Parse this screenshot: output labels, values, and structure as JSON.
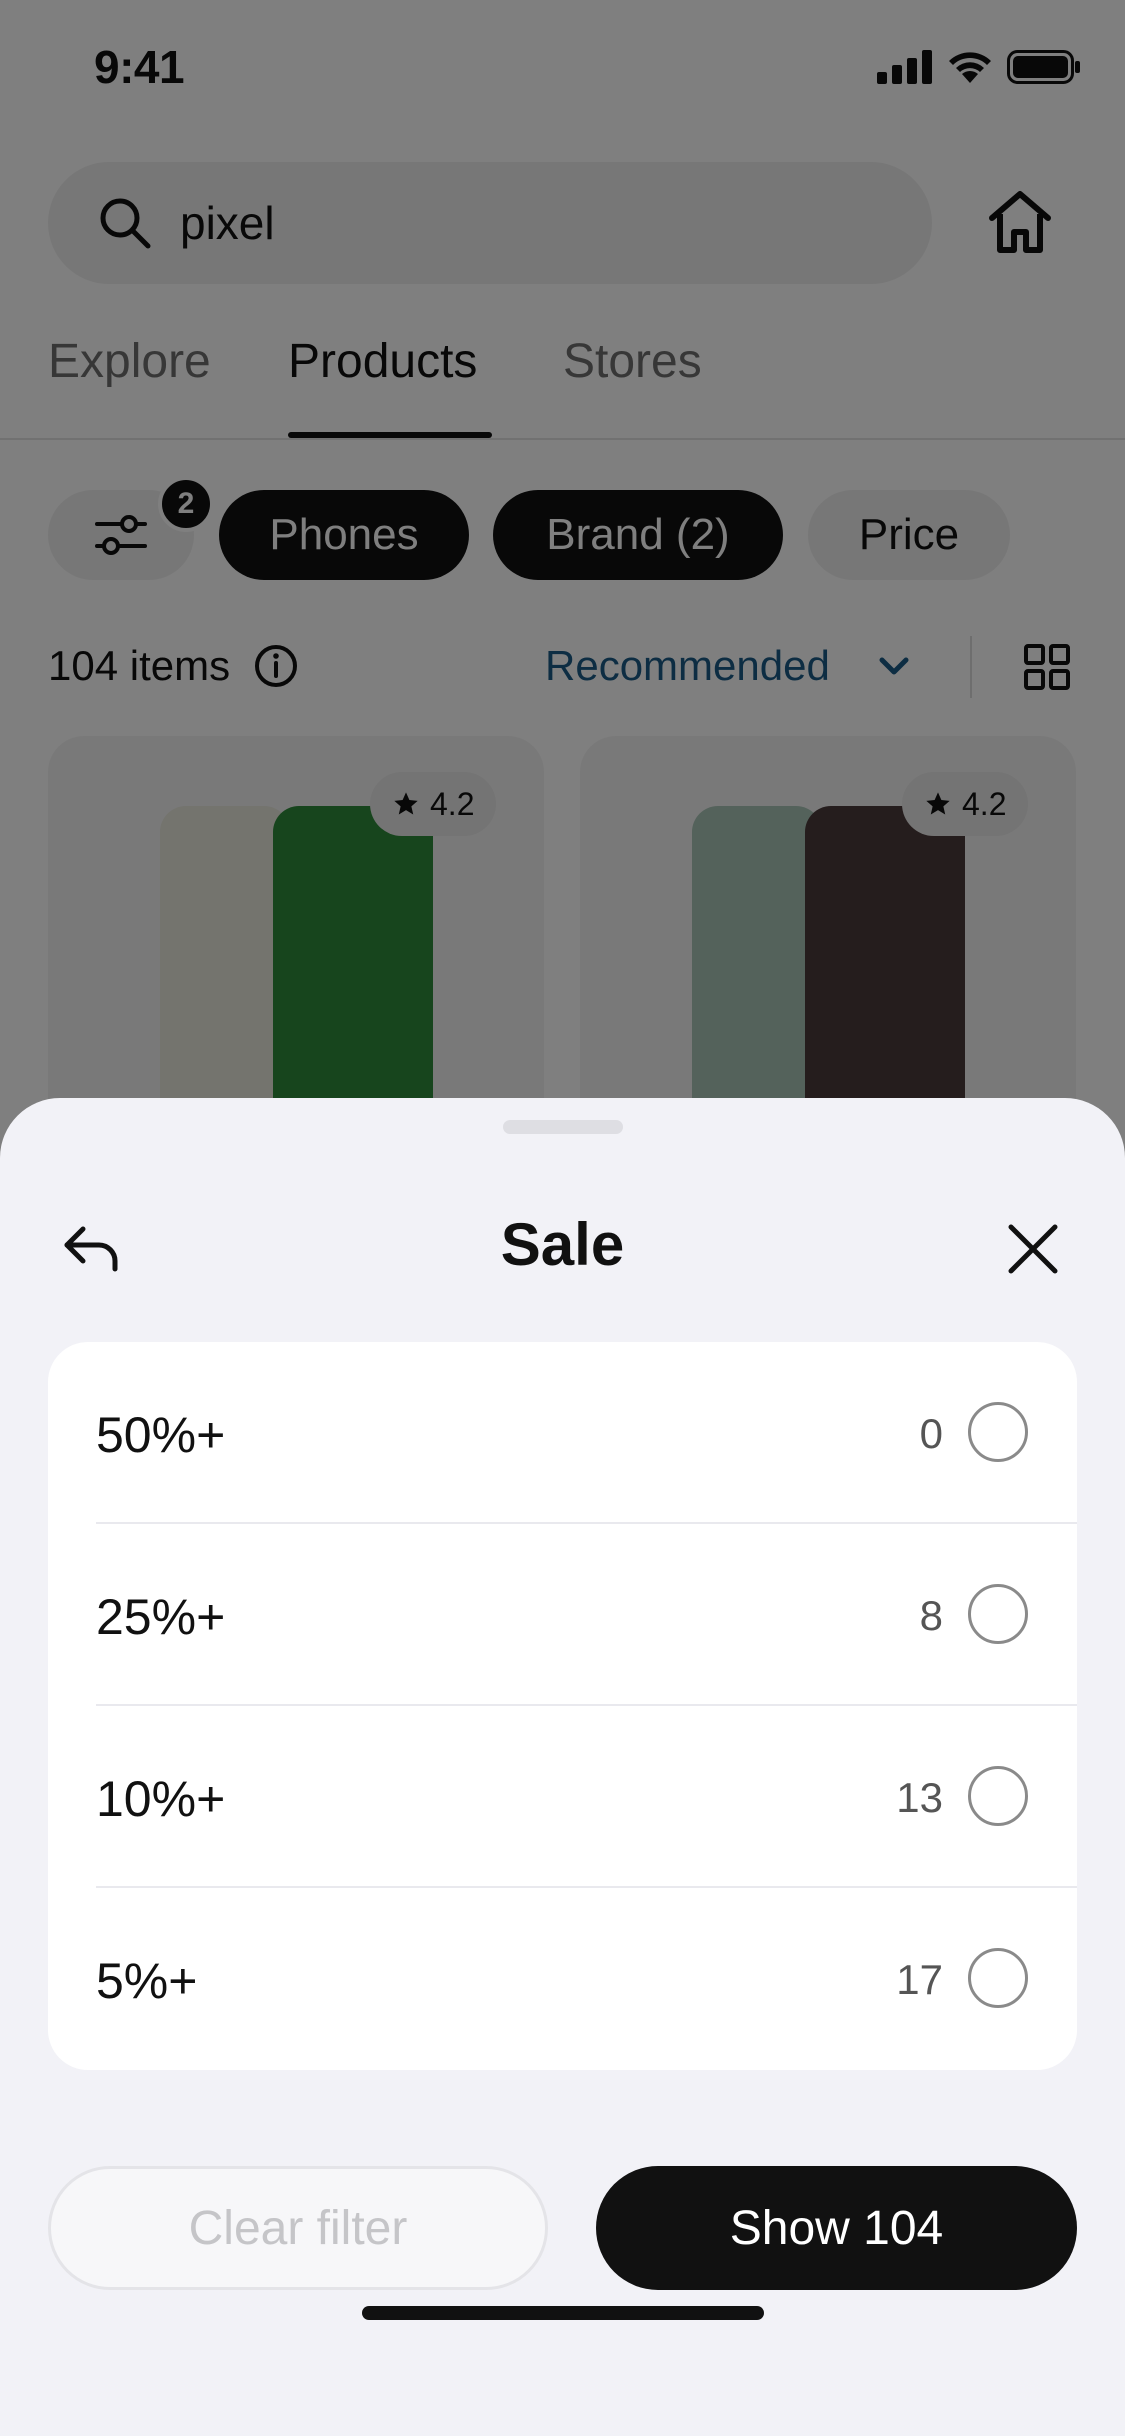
{
  "status_bar": {
    "time": "9:41",
    "icons": [
      "cellular-signal-icon",
      "wifi-icon",
      "battery-icon"
    ]
  },
  "search": {
    "query": "pixel",
    "icon": "search-icon",
    "home_icon": "home-icon"
  },
  "tabs": [
    {
      "label": "Explore",
      "active": false
    },
    {
      "label": "Products",
      "active": true
    },
    {
      "label": "Stores",
      "active": false
    }
  ],
  "filters": {
    "filter_icon": "sliders-icon",
    "active_count": "2",
    "chips": [
      {
        "label": "Phones",
        "selected": true
      },
      {
        "label": "Brand (2)",
        "selected": true
      },
      {
        "label": "Price",
        "selected": false
      }
    ]
  },
  "results": {
    "count_label": "104 items",
    "sort_label": "Recommended",
    "colors": {
      "sort": "#1a5b86"
    }
  },
  "products": [
    {
      "rating": "4.2"
    },
    {
      "rating": "4.2"
    }
  ],
  "sheet": {
    "title": "Sale",
    "back_icon": "back-arrow-icon",
    "close_icon": "close-icon",
    "options": [
      {
        "label": "50%+",
        "count": "0",
        "selected": false
      },
      {
        "label": "25%+",
        "count": "8",
        "selected": false
      },
      {
        "label": "10%+",
        "count": "13",
        "selected": false
      },
      {
        "label": "5%+",
        "count": "17",
        "selected": false
      }
    ],
    "clear_label": "Clear filter",
    "show_label": "Show 104"
  }
}
